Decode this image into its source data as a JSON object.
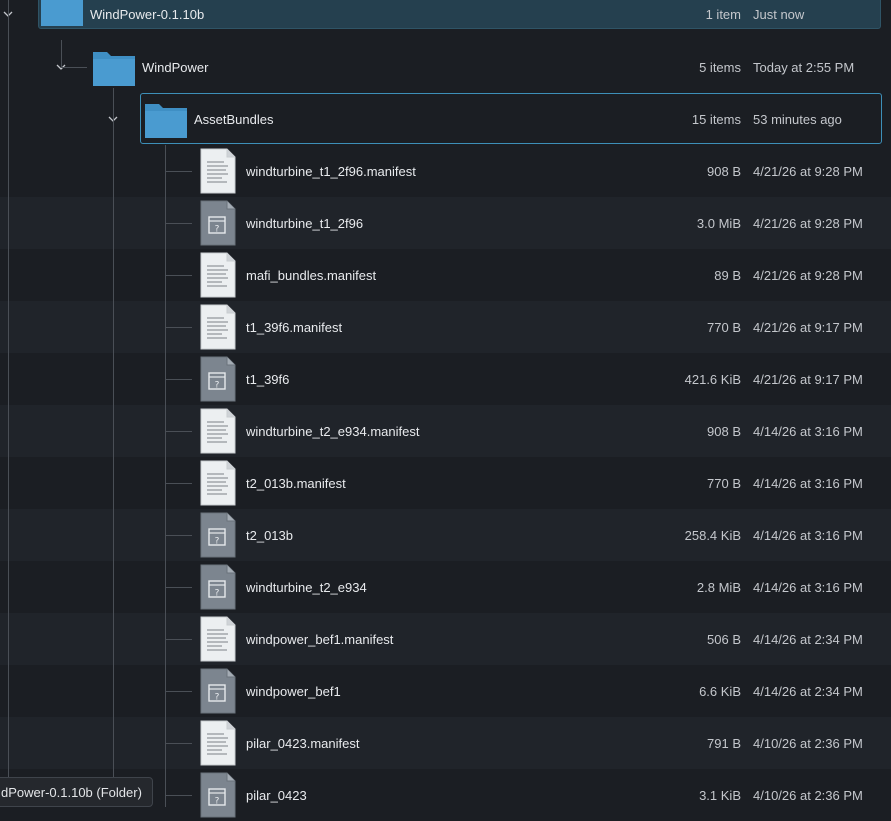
{
  "tree": {
    "folders": [
      {
        "name": "WindPower-0.1.10b",
        "count": "1 item",
        "modified": "Just now"
      },
      {
        "name": "WindPower",
        "count": "5 items",
        "modified": "Today at 2:55 PM"
      },
      {
        "name": "AssetBundles",
        "count": "15 items",
        "modified": "53 minutes ago"
      }
    ],
    "files": [
      {
        "name": "windturbine_t1_2f96.manifest",
        "size": "908 B",
        "modified": "4/21/26 at 9:28 PM",
        "icon": "text-document-icon"
      },
      {
        "name": "windturbine_t1_2f96",
        "size": "3.0 MiB",
        "modified": "4/21/26 at 9:28 PM",
        "icon": "unknown-file-icon"
      },
      {
        "name": "mafi_bundles.manifest",
        "size": "89 B",
        "modified": "4/21/26 at 9:28 PM",
        "icon": "text-document-icon"
      },
      {
        "name": "t1_39f6.manifest",
        "size": "770 B",
        "modified": "4/21/26 at 9:17 PM",
        "icon": "text-document-icon"
      },
      {
        "name": "t1_39f6",
        "size": "421.6 KiB",
        "modified": "4/21/26 at 9:17 PM",
        "icon": "unknown-file-icon"
      },
      {
        "name": "windturbine_t2_e934.manifest",
        "size": "908 B",
        "modified": "4/14/26 at 3:16 PM",
        "icon": "text-document-icon"
      },
      {
        "name": "t2_013b.manifest",
        "size": "770 B",
        "modified": "4/14/26 at 3:16 PM",
        "icon": "text-document-icon"
      },
      {
        "name": "t2_013b",
        "size": "258.4 KiB",
        "modified": "4/14/26 at 3:16 PM",
        "icon": "unknown-file-icon"
      },
      {
        "name": "windturbine_t2_e934",
        "size": "2.8 MiB",
        "modified": "4/14/26 at 3:16 PM",
        "icon": "unknown-file-icon"
      },
      {
        "name": "windpower_bef1.manifest",
        "size": "506 B",
        "modified": "4/14/26 at 2:34 PM",
        "icon": "text-document-icon"
      },
      {
        "name": "windpower_bef1",
        "size": "6.6 KiB",
        "modified": "4/14/26 at 2:34 PM",
        "icon": "unknown-file-icon"
      },
      {
        "name": "pilar_0423.manifest",
        "size": "791 B",
        "modified": "4/10/26 at 2:36 PM",
        "icon": "text-document-icon"
      },
      {
        "name": "pilar_0423",
        "size": "3.1 KiB",
        "modified": "4/10/26 at 2:36 PM",
        "icon": "unknown-file-icon"
      }
    ]
  },
  "tooltip": {
    "text": "dPower-0.1.10b (Folder)"
  },
  "colors": {
    "background": "#1b1e23",
    "alt_row": "#20242a",
    "selection": "#25404f",
    "focus_border": "#3d8fb8",
    "folder_blue": "#4a9bd0"
  }
}
